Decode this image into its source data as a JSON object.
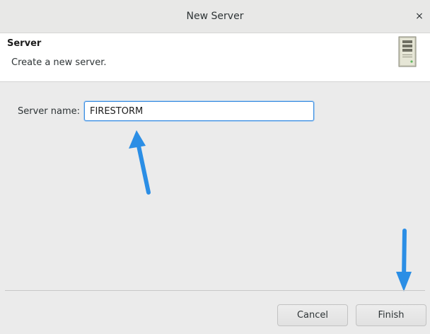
{
  "window": {
    "title": "New Server",
    "close_glyph": "×"
  },
  "header": {
    "title": "Server",
    "description": "Create a new server.",
    "icon": "server-icon"
  },
  "form": {
    "server_name_label": "Server name:",
    "server_name_value": "FIRESTORM"
  },
  "buttons": {
    "cancel": "Cancel",
    "finish": "Finish"
  },
  "colors": {
    "accent": "#3d8ee0",
    "annotation_arrow": "#2b8ee5"
  }
}
